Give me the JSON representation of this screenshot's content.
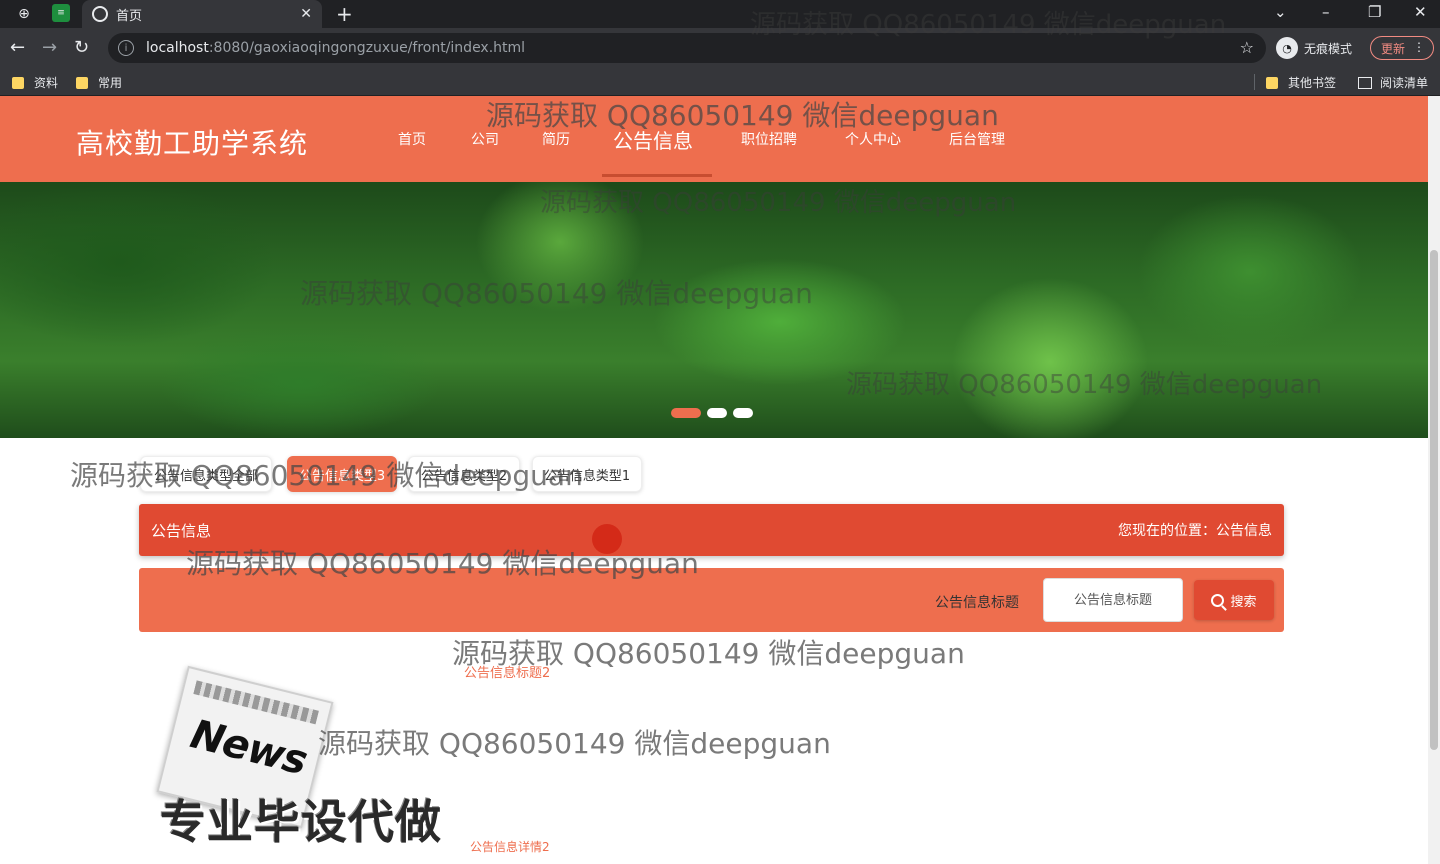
{
  "browser": {
    "tab_title": "首页",
    "url_host": "localhost",
    "url_path": ":8080/gaoxiaoqingongzuxue/front/index.html",
    "incognito_label": "无痕模式",
    "update_label": "更新",
    "bookmarks": [
      "资料",
      "常用"
    ],
    "bookmarks_right": [
      "其他书签",
      "阅读清单"
    ]
  },
  "header": {
    "site_title": "高校勤工助学系统",
    "nav": [
      "首页",
      "公司",
      "简历",
      "公告信息",
      "职位招聘",
      "个人中心",
      "后台管理"
    ],
    "active_nav": "公告信息",
    "brand_color": "#ee6e4e"
  },
  "banner": {
    "active_slide": 1,
    "slide_count": 3
  },
  "type_tabs": [
    "公告信息类型全部",
    "公告信息类型3",
    "公告信息类型2",
    "公告信息类型1"
  ],
  "selected_type_tab": "公告信息类型3",
  "section": {
    "title": "公告信息",
    "location_label": "您现在的位置：公告信息"
  },
  "search": {
    "label": "公告信息标题",
    "placeholder": "公告信息标题",
    "button_label": "搜索"
  },
  "news_list": [
    {
      "title": "公告信息标题2",
      "detail": "公告信息详情2"
    }
  ],
  "overlay": {
    "news_graphic_word": "News",
    "promo_text": "专业毕设代做",
    "watermark": "源码获取 QQ86050149 微信deepguan"
  }
}
